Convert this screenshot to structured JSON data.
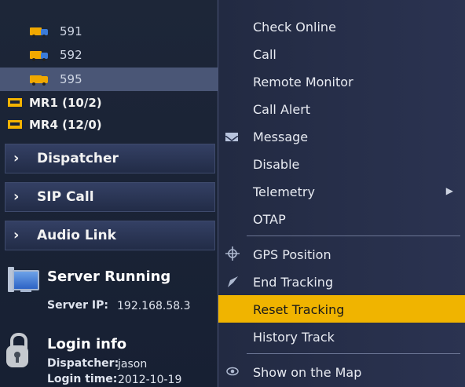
{
  "tree": {
    "vehicles": [
      {
        "number": "591"
      },
      {
        "number": "592"
      },
      {
        "number": "595"
      }
    ],
    "groups": [
      {
        "label": "MR1 (10/2)"
      },
      {
        "label": "MR4 (12/0)"
      }
    ]
  },
  "sections": [
    {
      "label": "Dispatcher"
    },
    {
      "label": "SIP Call"
    },
    {
      "label": "Audio Link"
    }
  ],
  "server": {
    "title": "Server Running",
    "ip_label": "Server IP:",
    "ip_value": "192.168.58.3"
  },
  "login": {
    "title": "Login info",
    "dispatcher_label": "Dispatcher:",
    "dispatcher_value": "jason",
    "time_label": "Login time:",
    "time_value": "2012-10-19"
  },
  "menu": {
    "items": [
      {
        "label": "Check Online"
      },
      {
        "label": "Call"
      },
      {
        "label": "Remote Monitor"
      },
      {
        "label": "Call Alert"
      },
      {
        "label": "Message",
        "icon": "envelope-icon"
      },
      {
        "label": "Disable"
      },
      {
        "label": "Telemetry",
        "submenu": true
      },
      {
        "label": "OTAP"
      },
      {
        "label": "GPS Position",
        "icon": "crosshair-icon"
      },
      {
        "label": "End Tracking",
        "icon": "flag-icon"
      },
      {
        "label": "Reset Tracking",
        "highlighted": true
      },
      {
        "label": "History Track"
      },
      {
        "label": "Show on the Map",
        "icon": "eye-icon"
      }
    ]
  },
  "colors": {
    "menu_highlight": "#f0b400",
    "panel_bg": "#1a2233",
    "group_icon": "#f3b300"
  }
}
